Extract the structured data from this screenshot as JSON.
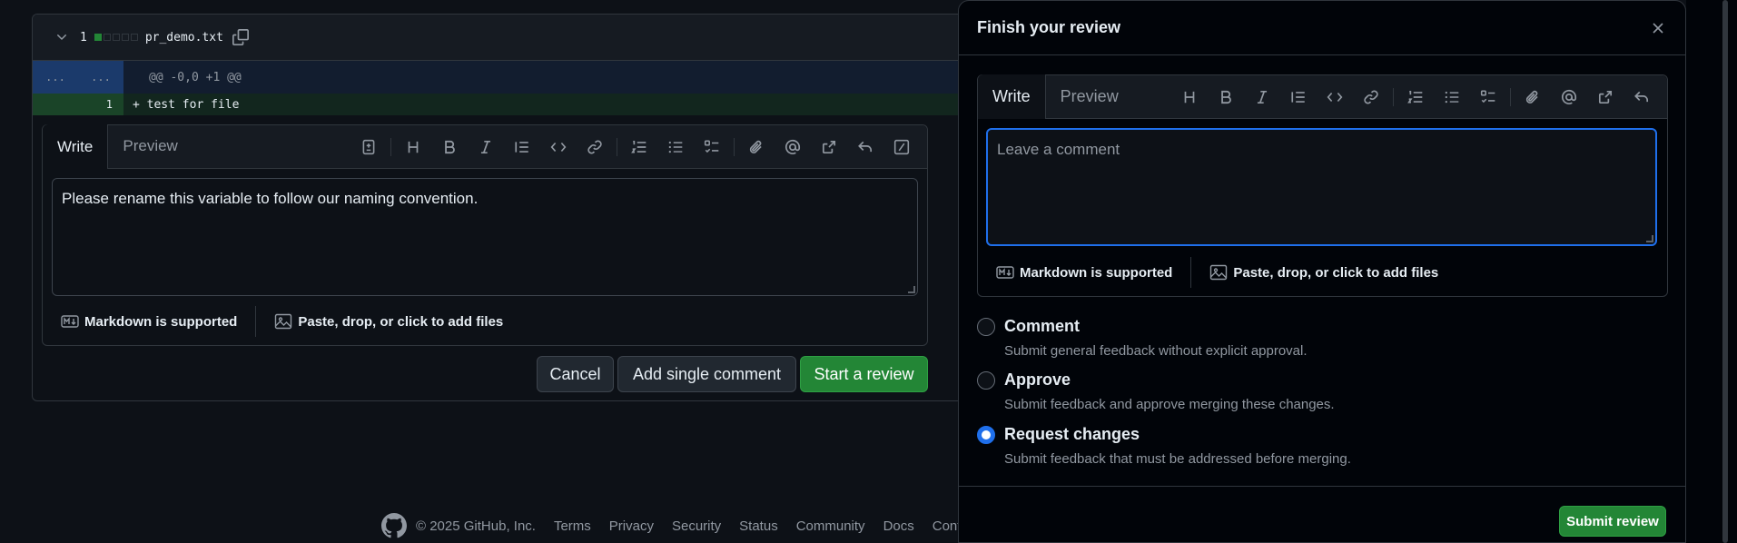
{
  "file": {
    "change_count": "1",
    "filename": "pr_demo.txt",
    "hunk_old": "...",
    "hunk_new": "...",
    "hunk_header": "@@ -0,0 +1 @@",
    "added_line_number": "1",
    "added_line": "+ test for file"
  },
  "inline_comment": {
    "tabs": [
      "Write",
      "Preview"
    ],
    "text": "Please rename this variable to follow our naming convention.",
    "markdown_label": "Markdown is supported",
    "attach_label": "Paste, drop, or click to add files",
    "cancel": "Cancel",
    "add_single": "Add single comment",
    "start_review": "Start a review"
  },
  "footer": {
    "copyright": "© 2025 GitHub, Inc.",
    "links": [
      "Terms",
      "Privacy",
      "Security",
      "Status",
      "Community",
      "Docs",
      "Conta"
    ]
  },
  "review_dialog": {
    "title": "Finish your review",
    "tabs": [
      "Write",
      "Preview"
    ],
    "placeholder": "Leave a comment",
    "markdown_label": "Markdown is supported",
    "attach_label": "Paste, drop, or click to add files",
    "options": [
      {
        "label": "Comment",
        "desc": "Submit general feedback without explicit approval.",
        "selected": false
      },
      {
        "label": "Approve",
        "desc": "Submit feedback and approve merging these changes.",
        "selected": false
      },
      {
        "label": "Request changes",
        "desc": "Submit feedback that must be addressed before merging.",
        "selected": true
      }
    ],
    "submit": "Submit review"
  },
  "colors": {
    "accent": "#1f6feb",
    "success": "#238636",
    "background": "#0d1117"
  }
}
